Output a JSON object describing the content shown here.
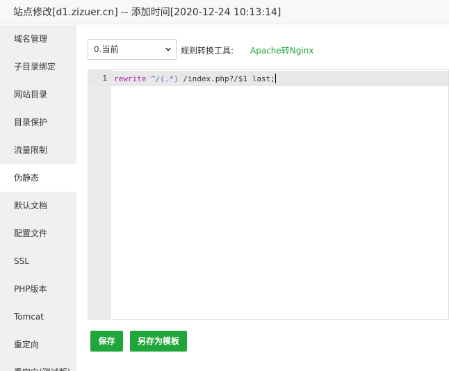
{
  "title": "站点修改[d1.zizuer.cn] -- 添加时间[2020-12-24 10:13:14]",
  "sidebar": {
    "items": [
      {
        "label": "域名管理"
      },
      {
        "label": "子目录绑定"
      },
      {
        "label": "网站目录"
      },
      {
        "label": "目录保护"
      },
      {
        "label": "流量限制"
      },
      {
        "label": "伪静态",
        "active": true
      },
      {
        "label": "默认文档"
      },
      {
        "label": "配置文件"
      },
      {
        "label": "SSL"
      },
      {
        "label": "PHP版本"
      },
      {
        "label": "Tomcat"
      },
      {
        "label": "重定向"
      },
      {
        "label": "重定向(测试版)"
      }
    ]
  },
  "toolbar": {
    "select_value": "0.当前",
    "tool_label": "规则转换工具:",
    "tool_link": "Apache转Nginx"
  },
  "editor": {
    "line_number": "1",
    "code": {
      "keyword": "rewrite",
      "pattern": "^/(.*)",
      "rest": " /index.php?/$1 last;"
    }
  },
  "buttons": {
    "save": "保存",
    "save_as_template": "另存为模板"
  },
  "colors": {
    "accent": "#20a53a",
    "keyword": "#a626a4",
    "regex": "#6a5acd"
  },
  "icons": {
    "select": "chevron-down-icon"
  }
}
